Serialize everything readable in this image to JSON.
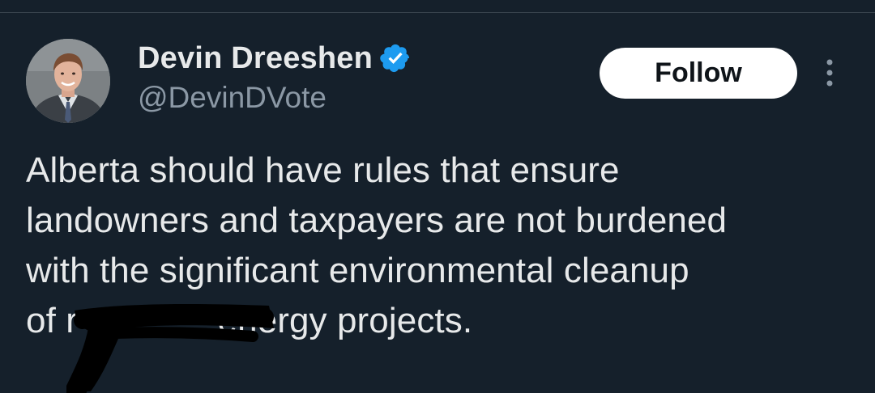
{
  "tweet": {
    "author": {
      "display_name": "Devin Dreeshen",
      "handle": "@DevinDVote",
      "verified": true
    },
    "follow_button_label": "Follow",
    "text_lines": [
      "Alberta should have rules that ensure",
      "landowners and taxpayers are not burdened",
      "with the significant environmental cleanup",
      "of r              energy projects."
    ]
  },
  "icons": {
    "verified": "verified-badge-icon",
    "more": "more-vertical-icon"
  },
  "colors": {
    "background": "#15202b",
    "primary_text": "#e7e9ea",
    "secondary_text": "#8b98a5",
    "verified_blue": "#1d9bf0",
    "follow_bg": "#ffffff",
    "follow_text": "#0f1419",
    "divider": "#38444d"
  }
}
